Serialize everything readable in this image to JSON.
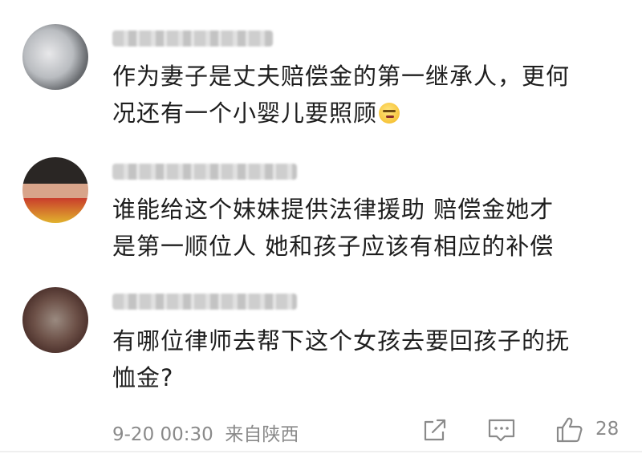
{
  "comments": [
    {
      "text_line1": "作为妻子是丈夫赔偿金的第一继承人，更何",
      "text_line2": "况还有一个小婴儿要照顾",
      "emoji_icon": "grimace-emoji-icon"
    },
    {
      "text_line1": "谁能给这个妹妹提供法律援助  赔偿金她才",
      "text_line2": "是第一顺位人  她和孩子应该有相应的补偿"
    },
    {
      "text_line1": "有哪位律师去帮下这个女孩去要回孩子的抚",
      "text_line2": "恤金?"
    }
  ],
  "footer": {
    "timestamp": "9-20 00:30",
    "location": "来自陕西",
    "like_count": "28",
    "icons": [
      "share-icon",
      "comment-icon",
      "thumbs-up-icon"
    ]
  },
  "colors": {
    "text": "#1e1e1e",
    "meta": "#8a8a8a",
    "background": "#ffffff"
  }
}
